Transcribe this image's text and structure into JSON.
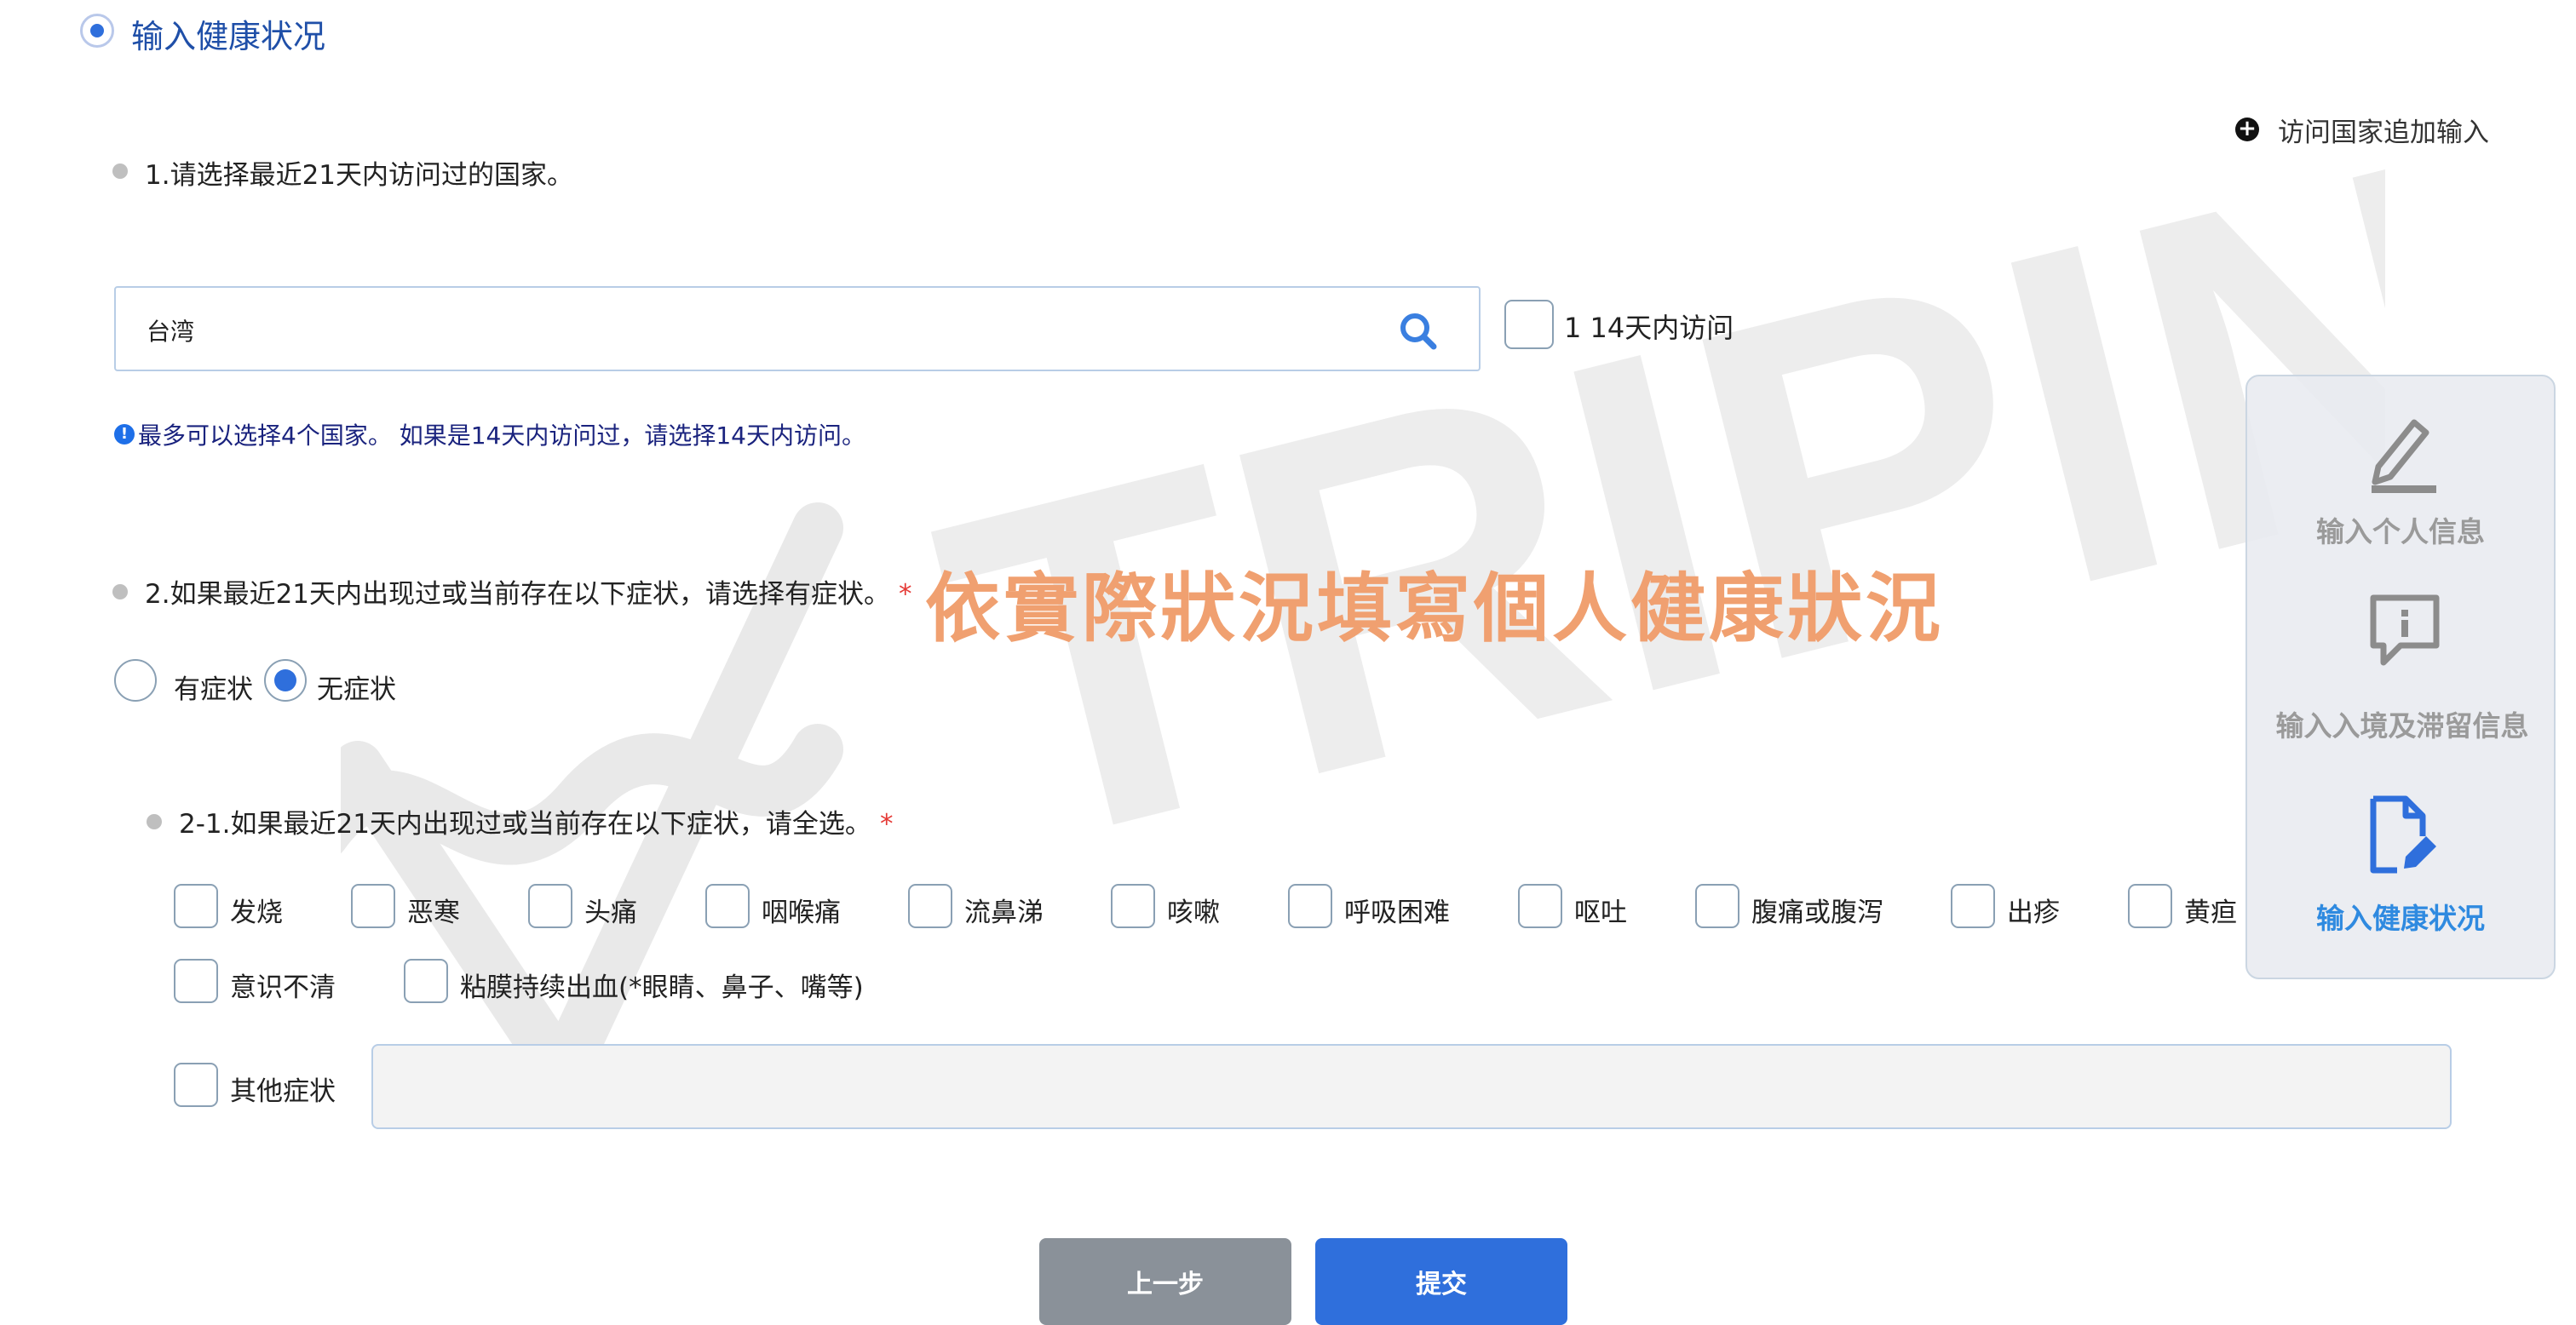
{
  "section": {
    "title": "输入健康状况"
  },
  "add_country": {
    "label": "访问国家追加输入"
  },
  "q1": {
    "text": "1.请选择最近21天内访问过的国家。",
    "search_value": "台湾",
    "visited14": {
      "label": "1 14天内访问",
      "checked": false
    },
    "info": "最多可以选择4个国家。 如果是14天内访问过，请选择14天内访问。"
  },
  "q2": {
    "text": "2.如果最近21天内出现过或当前存在以下症状，请选择有症状。",
    "required_mark": "*",
    "options": [
      {
        "label": "有症状",
        "selected": false
      },
      {
        "label": "无症状",
        "selected": true
      }
    ]
  },
  "q21": {
    "text": "2-1.如果最近21天内出现过或当前存在以下症状，请全选。",
    "required_mark": "*",
    "symptoms_row1": [
      "发烧",
      "恶寒",
      "头痛",
      "咽喉痛",
      "流鼻涕",
      "咳嗽",
      "呼吸困难",
      "呕吐",
      "腹痛或腹泻",
      "出疹",
      "黄疸"
    ],
    "symptoms_row2": [
      "意识不清",
      "粘膜持续出血(*眼睛、鼻子、嘴等)"
    ],
    "other_label": "其他症状",
    "other_value": ""
  },
  "overlay_caption": "依實際狀況填寫個人健康狀況",
  "watermark": "TRIPIN",
  "sidebar": {
    "steps": [
      {
        "label": "输入个人信息",
        "icon": "pencil-icon",
        "active": false
      },
      {
        "label": "输入入境及滞留信息",
        "icon": "info-bubble-icon",
        "active": false
      },
      {
        "label": "输入健康状况",
        "icon": "document-edit-icon",
        "active": true
      }
    ]
  },
  "buttons": {
    "prev": "上一步",
    "submit": "提交"
  },
  "colors": {
    "accent": "#2f6fdc",
    "title": "#1f4fa8",
    "overlay": "#f0a070",
    "prev_button": "#8a9199",
    "required": "#e53935"
  }
}
